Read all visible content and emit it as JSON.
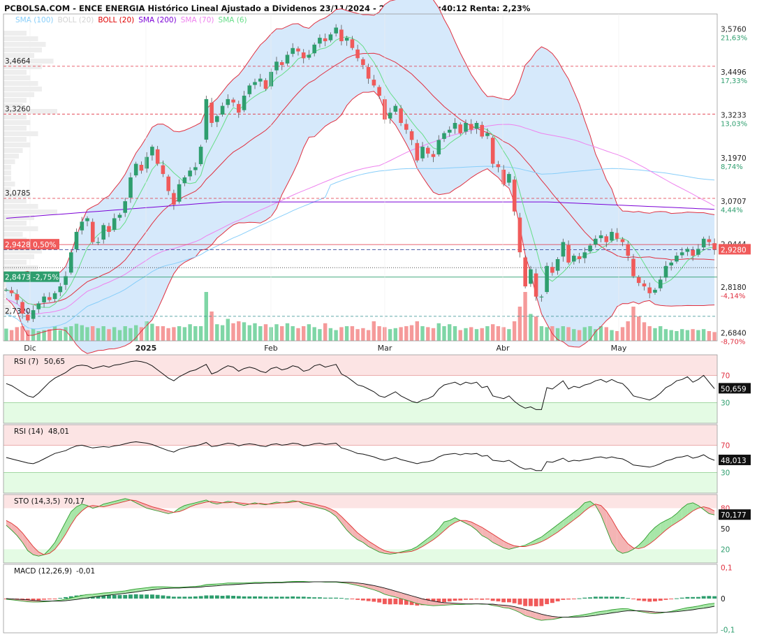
{
  "header": {
    "title": "PCBOLSA.COM - ENCE ENERGIA Histórico Lineal Ajustado a Dividenos 23/11/2024 - 23/5/2025 , 9:40:12 Renta: 2,23%",
    "legend": [
      {
        "label": "SMA (100)",
        "color": "#87CEFA"
      },
      {
        "label": "BOLL (20)",
        "color": "#D3D3D3"
      },
      {
        "label": "BOLL (20)",
        "color": "#E00000"
      },
      {
        "label": "SMA (200)",
        "color": "#7B00D6"
      },
      {
        "label": "SMA (70)",
        "color": "#EE82EE"
      },
      {
        "label": "SMA (6)",
        "color": "#66DD88"
      }
    ]
  },
  "colors": {
    "up": "#2E9E6E",
    "down": "#F05A5A",
    "band_fill": "#D6E9FB",
    "band_line": "#E03040",
    "sma6": "#66DD88",
    "sma70": "#EE82EE",
    "sma100": "#87CEFA",
    "sma200": "#7B00D6",
    "last_price_bg": "#F05A5A",
    "rsi_over": "#FCE4E4",
    "rsi_under": "#E4FBE4",
    "price_tag_green": "#2E9E6E",
    "price_tag_red": "#F05A5A"
  },
  "chart_data": [
    {
      "type": "candlestick",
      "name": "price",
      "x_labels": [
        "Dic",
        "2025",
        "Feb",
        "Mar",
        "Abr",
        "May"
      ],
      "ylim": [
        2.66,
        3.62
      ],
      "right_axis": [
        {
          "price": "3,5760",
          "pct": "21,63%"
        },
        {
          "price": "3,4496",
          "pct": "17,33%"
        },
        {
          "price": "3,3233",
          "pct": "13,03%"
        },
        {
          "price": "3,1970",
          "pct": "8,74%"
        },
        {
          "price": "3,0707",
          "pct": "4,44%"
        },
        {
          "price": "2,9444",
          "pct": ""
        },
        {
          "price": "2,8180",
          "pct": "-4,14%"
        },
        {
          "price": "2,6840",
          "pct": "-8,70%"
        }
      ],
      "left_levels": [
        {
          "label": "3,4664",
          "value": 3.4664
        },
        {
          "label": "3,3260",
          "value": 3.326
        },
        {
          "label": "3,0785",
          "value": 3.0785
        },
        {
          "label": "2,7320",
          "value": 2.732
        }
      ],
      "ref_tags": [
        {
          "label": "2,9428  0,50%",
          "value": 2.9428
        },
        {
          "label": "2,8473  -2,75%",
          "value": 2.8473
        }
      ],
      "last_price": {
        "label": "2,9280",
        "value": 2.928
      },
      "dotted_level": 2.875,
      "closes": [
        2.81,
        2.8,
        2.78,
        2.74,
        2.72,
        2.75,
        2.77,
        2.79,
        2.78,
        2.8,
        2.82,
        2.85,
        2.92,
        2.98,
        3.01,
        3.02,
        2.95,
        2.95,
        3.0,
        2.98,
        3.02,
        3.03,
        3.07,
        3.14,
        3.18,
        3.16,
        3.2,
        3.23,
        3.18,
        3.15,
        3.1,
        3.06,
        3.12,
        3.14,
        3.16,
        3.17,
        3.23,
        3.37,
        3.3,
        3.32,
        3.35,
        3.37,
        3.36,
        3.33,
        3.38,
        3.41,
        3.42,
        3.43,
        3.4,
        3.45,
        3.48,
        3.47,
        3.5,
        3.52,
        3.51,
        3.49,
        3.5,
        3.53,
        3.55,
        3.54,
        3.56,
        3.58,
        3.54,
        3.55,
        3.52,
        3.49,
        3.47,
        3.43,
        3.41,
        3.38,
        3.31,
        3.33,
        3.35,
        3.3,
        3.28,
        3.25,
        3.19,
        3.23,
        3.21,
        3.2,
        3.25,
        3.27,
        3.28,
        3.3,
        3.27,
        3.3,
        3.28,
        3.3,
        3.26,
        3.27,
        3.18,
        3.17,
        3.12,
        3.15,
        3.04,
        2.92,
        2.82,
        2.87,
        2.79,
        2.79,
        2.88,
        2.86,
        2.9,
        2.95,
        2.89,
        2.91,
        2.9,
        2.92,
        2.94,
        2.96,
        2.97,
        2.95,
        2.98,
        2.96,
        2.95,
        2.91,
        2.85,
        2.83,
        2.82,
        2.8,
        2.81,
        2.84,
        2.88,
        2.89,
        2.91,
        2.92,
        2.93,
        2.91,
        2.93,
        2.96,
        2.95,
        2.928
      ],
      "volume_relative": [
        0.25,
        0.22,
        0.28,
        0.3,
        0.22,
        0.25,
        0.2,
        0.22,
        0.24,
        0.3,
        0.22,
        0.28,
        0.3,
        0.35,
        0.32,
        0.28,
        0.3,
        0.26,
        0.3,
        0.24,
        0.28,
        0.22,
        0.3,
        0.26,
        0.32,
        0.28,
        0.4,
        0.35,
        0.3,
        0.3,
        0.26,
        0.28,
        0.3,
        0.28,
        0.34,
        0.3,
        0.3,
        1.0,
        0.6,
        0.34,
        0.32,
        0.45,
        0.36,
        0.4,
        0.38,
        0.32,
        0.36,
        0.3,
        0.34,
        0.28,
        0.34,
        0.3,
        0.36,
        0.3,
        0.26,
        0.3,
        0.34,
        0.28,
        0.24,
        0.36,
        0.26,
        0.22,
        0.28,
        0.3,
        0.3,
        0.24,
        0.26,
        0.22,
        0.4,
        0.3,
        0.28,
        0.24,
        0.26,
        0.28,
        0.3,
        0.32,
        0.4,
        0.3,
        0.28,
        0.26,
        0.36,
        0.3,
        0.34,
        0.3,
        0.22,
        0.26,
        0.28,
        0.24,
        0.26,
        0.3,
        0.34,
        0.3,
        0.28,
        0.24,
        0.4,
        0.7,
        1.0,
        0.55,
        0.5,
        0.3,
        0.28,
        0.3,
        0.26,
        0.3,
        0.28,
        0.24,
        0.22,
        0.28,
        0.3,
        0.24,
        0.3,
        0.28,
        0.22,
        0.2,
        0.28,
        0.4,
        0.7,
        0.5,
        0.38,
        0.3,
        0.26,
        0.3,
        0.24,
        0.22,
        0.2,
        0.24,
        0.22,
        0.24,
        0.22,
        0.24,
        0.2,
        0.18
      ]
    },
    {
      "type": "line",
      "name": "RSI (7)",
      "label": "RSI (7)",
      "value_label": "50,65",
      "last_label": "50,659",
      "ylim": [
        0,
        100
      ],
      "levels": [
        70,
        30
      ],
      "values": [
        58,
        55,
        50,
        45,
        40,
        38,
        44,
        52,
        60,
        66,
        70,
        74,
        80,
        84,
        85,
        84,
        80,
        82,
        84,
        82,
        85,
        86,
        88,
        90,
        91,
        90,
        88,
        84,
        78,
        72,
        66,
        62,
        68,
        72,
        76,
        78,
        82,
        86,
        72,
        75,
        80,
        84,
        82,
        76,
        80,
        82,
        80,
        76,
        74,
        80,
        82,
        78,
        80,
        84,
        82,
        76,
        78,
        84,
        86,
        82,
        84,
        86,
        72,
        68,
        62,
        56,
        54,
        50,
        46,
        40,
        38,
        42,
        46,
        40,
        36,
        32,
        30,
        34,
        36,
        40,
        50,
        56,
        58,
        60,
        56,
        60,
        58,
        60,
        52,
        54,
        40,
        38,
        36,
        40,
        32,
        26,
        22,
        24,
        20,
        20,
        52,
        50,
        56,
        62,
        50,
        54,
        52,
        56,
        58,
        62,
        64,
        60,
        64,
        60,
        58,
        50,
        40,
        38,
        36,
        34,
        38,
        44,
        52,
        56,
        62,
        64,
        68,
        60,
        64,
        70,
        60,
        50.65
      ]
    },
    {
      "type": "line",
      "name": "RSI (14)",
      "label": "RSI (14)",
      "value_label": "48,01",
      "last_label": "48,013",
      "ylim": [
        0,
        100
      ],
      "levels": [
        70,
        30
      ],
      "values": [
        52,
        50,
        48,
        46,
        44,
        43,
        46,
        50,
        54,
        58,
        60,
        62,
        66,
        69,
        70,
        68,
        66,
        67,
        68,
        67,
        69,
        70,
        72,
        74,
        75,
        74,
        73,
        71,
        68,
        65,
        62,
        60,
        64,
        66,
        68,
        69,
        71,
        74,
        68,
        69,
        71,
        73,
        72,
        69,
        71,
        72,
        71,
        69,
        68,
        71,
        72,
        70,
        71,
        73,
        72,
        69,
        70,
        72,
        73,
        71,
        72,
        73,
        66,
        64,
        61,
        58,
        57,
        55,
        53,
        50,
        48,
        50,
        52,
        49,
        47,
        45,
        43,
        45,
        46,
        48,
        53,
        56,
        57,
        58,
        56,
        58,
        57,
        58,
        54,
        55,
        48,
        47,
        46,
        48,
        43,
        38,
        35,
        36,
        33,
        33,
        46,
        45,
        48,
        51,
        46,
        48,
        47,
        49,
        50,
        52,
        53,
        51,
        53,
        51,
        50,
        46,
        41,
        40,
        39,
        38,
        40,
        43,
        47,
        49,
        52,
        53,
        55,
        51,
        53,
        56,
        51,
        48.01
      ]
    },
    {
      "type": "line",
      "name": "STO (14,3,5)",
      "label": "STO (14,3,5)",
      "value_label": "70,17",
      "last_label": "70,177",
      "ylim": [
        0,
        100
      ],
      "levels": [
        80,
        20
      ],
      "tick_labels": [
        "80",
        "50",
        "20"
      ],
      "k": [
        55,
        48,
        40,
        30,
        18,
        12,
        10,
        12,
        20,
        30,
        45,
        60,
        75,
        82,
        86,
        84,
        80,
        82,
        86,
        88,
        90,
        92,
        94,
        92,
        88,
        84,
        80,
        78,
        76,
        74,
        72,
        74,
        80,
        84,
        86,
        88,
        90,
        92,
        88,
        86,
        88,
        90,
        89,
        86,
        84,
        86,
        88,
        86,
        85,
        87,
        89,
        88,
        89,
        91,
        90,
        86,
        84,
        82,
        80,
        78,
        74,
        68,
        58,
        48,
        40,
        34,
        30,
        24,
        20,
        16,
        14,
        13,
        14,
        16,
        18,
        20,
        24,
        30,
        36,
        42,
        50,
        60,
        62,
        66,
        62,
        58,
        54,
        48,
        40,
        36,
        30,
        26,
        22,
        20,
        22,
        24,
        26,
        30,
        34,
        38,
        44,
        50,
        56,
        62,
        68,
        74,
        80,
        88,
        90,
        84,
        70,
        50,
        30,
        18,
        14,
        16,
        20,
        26,
        34,
        44,
        52,
        58,
        62,
        66,
        72,
        80,
        86,
        88,
        84,
        78,
        72,
        70.17
      ],
      "d": [
        62,
        58,
        52,
        44,
        34,
        24,
        16,
        12,
        14,
        20,
        30,
        42,
        56,
        68,
        76,
        82,
        84,
        83,
        82,
        84,
        86,
        88,
        90,
        92,
        91,
        88,
        85,
        82,
        80,
        78,
        76,
        74,
        75,
        78,
        82,
        85,
        87,
        89,
        90,
        89,
        88,
        88,
        89,
        88,
        87,
        86,
        86,
        87,
        86,
        86,
        87,
        88,
        88,
        89,
        90,
        89,
        88,
        86,
        84,
        82,
        79,
        75,
        68,
        60,
        52,
        44,
        38,
        32,
        27,
        22,
        18,
        16,
        15,
        15,
        16,
        17,
        20,
        24,
        29,
        34,
        40,
        47,
        54,
        59,
        62,
        62,
        60,
        56,
        52,
        47,
        42,
        37,
        32,
        28,
        25,
        24,
        24,
        26,
        28,
        31,
        35,
        40,
        45,
        51,
        57,
        63,
        69,
        76,
        82,
        86,
        84,
        76,
        64,
        50,
        38,
        28,
        22,
        21,
        23,
        28,
        34,
        41,
        48,
        54,
        59,
        64,
        70,
        76,
        80,
        82,
        80,
        76
      ]
    },
    {
      "type": "line",
      "name": "MACD (12,26,9)",
      "label": "MACD (12,26,9)",
      "value_label": "-0,01",
      "tick_labels": [
        "0,1",
        "0",
        "-0,1"
      ],
      "ylim": [
        -0.11,
        0.11
      ],
      "macd": [
        -0.002,
        -0.004,
        -0.006,
        -0.008,
        -0.01,
        -0.011,
        -0.011,
        -0.01,
        -0.009,
        -0.007,
        -0.005,
        -0.002,
        0.002,
        0.006,
        0.01,
        0.013,
        0.014,
        0.016,
        0.018,
        0.019,
        0.021,
        0.023,
        0.025,
        0.028,
        0.031,
        0.033,
        0.035,
        0.037,
        0.038,
        0.038,
        0.037,
        0.036,
        0.036,
        0.037,
        0.038,
        0.039,
        0.041,
        0.045,
        0.046,
        0.047,
        0.048,
        0.05,
        0.05,
        0.05,
        0.05,
        0.051,
        0.052,
        0.052,
        0.052,
        0.052,
        0.053,
        0.053,
        0.054,
        0.055,
        0.055,
        0.055,
        0.054,
        0.054,
        0.054,
        0.053,
        0.053,
        0.053,
        0.051,
        0.049,
        0.046,
        0.042,
        0.038,
        0.033,
        0.028,
        0.022,
        0.014,
        0.009,
        0.005,
        0.0,
        -0.005,
        -0.01,
        -0.016,
        -0.019,
        -0.021,
        -0.023,
        -0.022,
        -0.021,
        -0.02,
        -0.019,
        -0.019,
        -0.018,
        -0.018,
        -0.017,
        -0.018,
        -0.018,
        -0.022,
        -0.025,
        -0.029,
        -0.031,
        -0.037,
        -0.045,
        -0.055,
        -0.06,
        -0.066,
        -0.07,
        -0.068,
        -0.067,
        -0.064,
        -0.06,
        -0.059,
        -0.056,
        -0.054,
        -0.051,
        -0.048,
        -0.044,
        -0.041,
        -0.039,
        -0.036,
        -0.034,
        -0.032,
        -0.033,
        -0.037,
        -0.041,
        -0.044,
        -0.047,
        -0.048,
        -0.047,
        -0.044,
        -0.041,
        -0.037,
        -0.033,
        -0.029,
        -0.027,
        -0.024,
        -0.02,
        -0.017,
        -0.015
      ],
      "signal": [
        0.0,
        -0.001,
        -0.002,
        -0.003,
        -0.004,
        -0.006,
        -0.007,
        -0.008,
        -0.008,
        -0.008,
        -0.008,
        -0.007,
        -0.005,
        -0.003,
        0.0,
        0.002,
        0.005,
        0.007,
        0.009,
        0.011,
        0.013,
        0.015,
        0.017,
        0.019,
        0.021,
        0.024,
        0.026,
        0.028,
        0.03,
        0.032,
        0.033,
        0.034,
        0.034,
        0.035,
        0.036,
        0.036,
        0.037,
        0.039,
        0.04,
        0.041,
        0.043,
        0.044,
        0.045,
        0.046,
        0.047,
        0.048,
        0.049,
        0.049,
        0.05,
        0.05,
        0.051,
        0.051,
        0.052,
        0.052,
        0.053,
        0.053,
        0.053,
        0.054,
        0.054,
        0.054,
        0.054,
        0.054,
        0.053,
        0.053,
        0.052,
        0.05,
        0.048,
        0.045,
        0.042,
        0.038,
        0.034,
        0.029,
        0.024,
        0.019,
        0.014,
        0.009,
        0.004,
        -0.001,
        -0.005,
        -0.008,
        -0.011,
        -0.013,
        -0.014,
        -0.015,
        -0.016,
        -0.017,
        -0.017,
        -0.017,
        -0.017,
        -0.018,
        -0.018,
        -0.02,
        -0.021,
        -0.023,
        -0.026,
        -0.03,
        -0.035,
        -0.04,
        -0.045,
        -0.05,
        -0.054,
        -0.057,
        -0.059,
        -0.06,
        -0.06,
        -0.06,
        -0.059,
        -0.058,
        -0.056,
        -0.054,
        -0.051,
        -0.049,
        -0.046,
        -0.044,
        -0.041,
        -0.039,
        -0.039,
        -0.039,
        -0.04,
        -0.041,
        -0.043,
        -0.044,
        -0.044,
        -0.043,
        -0.042,
        -0.04,
        -0.038,
        -0.036,
        -0.033,
        -0.031,
        -0.028,
        -0.025
      ]
    }
  ]
}
